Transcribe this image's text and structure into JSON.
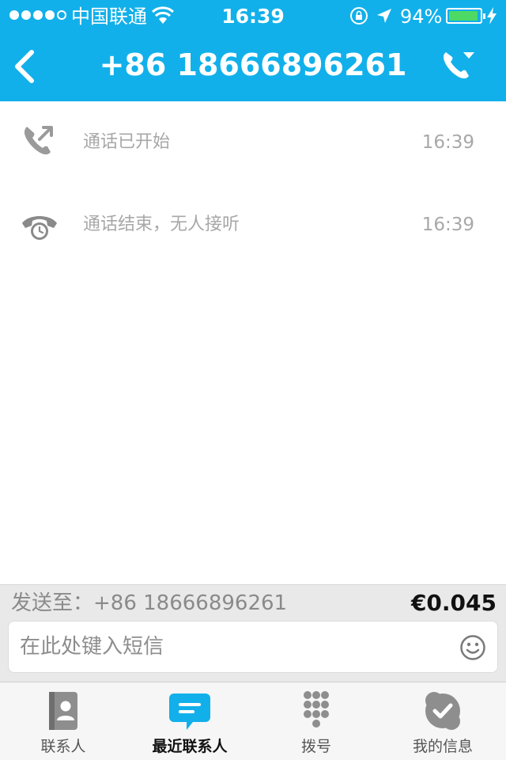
{
  "status_bar": {
    "carrier": "中国联通",
    "time": "16:39",
    "battery_percent": "94%",
    "battery_level": 0.94
  },
  "nav": {
    "title": "+86 18666896261",
    "back_icon": "chevron-left-icon",
    "call_icon": "phone-dropdown-icon"
  },
  "messages": [
    {
      "icon": "outgoing-call-icon",
      "text": "通话已开始",
      "time": "16:39"
    },
    {
      "icon": "missed-call-clock-icon",
      "text": "通话结束，无人接听",
      "time": "16:39"
    }
  ],
  "compose": {
    "send_to": "发送至：+86 18666896261",
    "price": "€0.045",
    "placeholder": "在此处键入短信",
    "value": ""
  },
  "tabs": [
    {
      "label": "联系人",
      "icon": "contacts-book-icon",
      "active": false
    },
    {
      "label": "最近联系人",
      "icon": "chat-bubble-icon",
      "active": true
    },
    {
      "label": "拨号",
      "icon": "dialpad-icon",
      "active": false
    },
    {
      "label": "我的信息",
      "icon": "profile-check-icon",
      "active": false
    }
  ],
  "colors": {
    "accent": "#12b0ea",
    "tab_inactive_icon": "#8e8e8e",
    "battery": "#4cd964",
    "muted_text": "#a8a8a8"
  }
}
